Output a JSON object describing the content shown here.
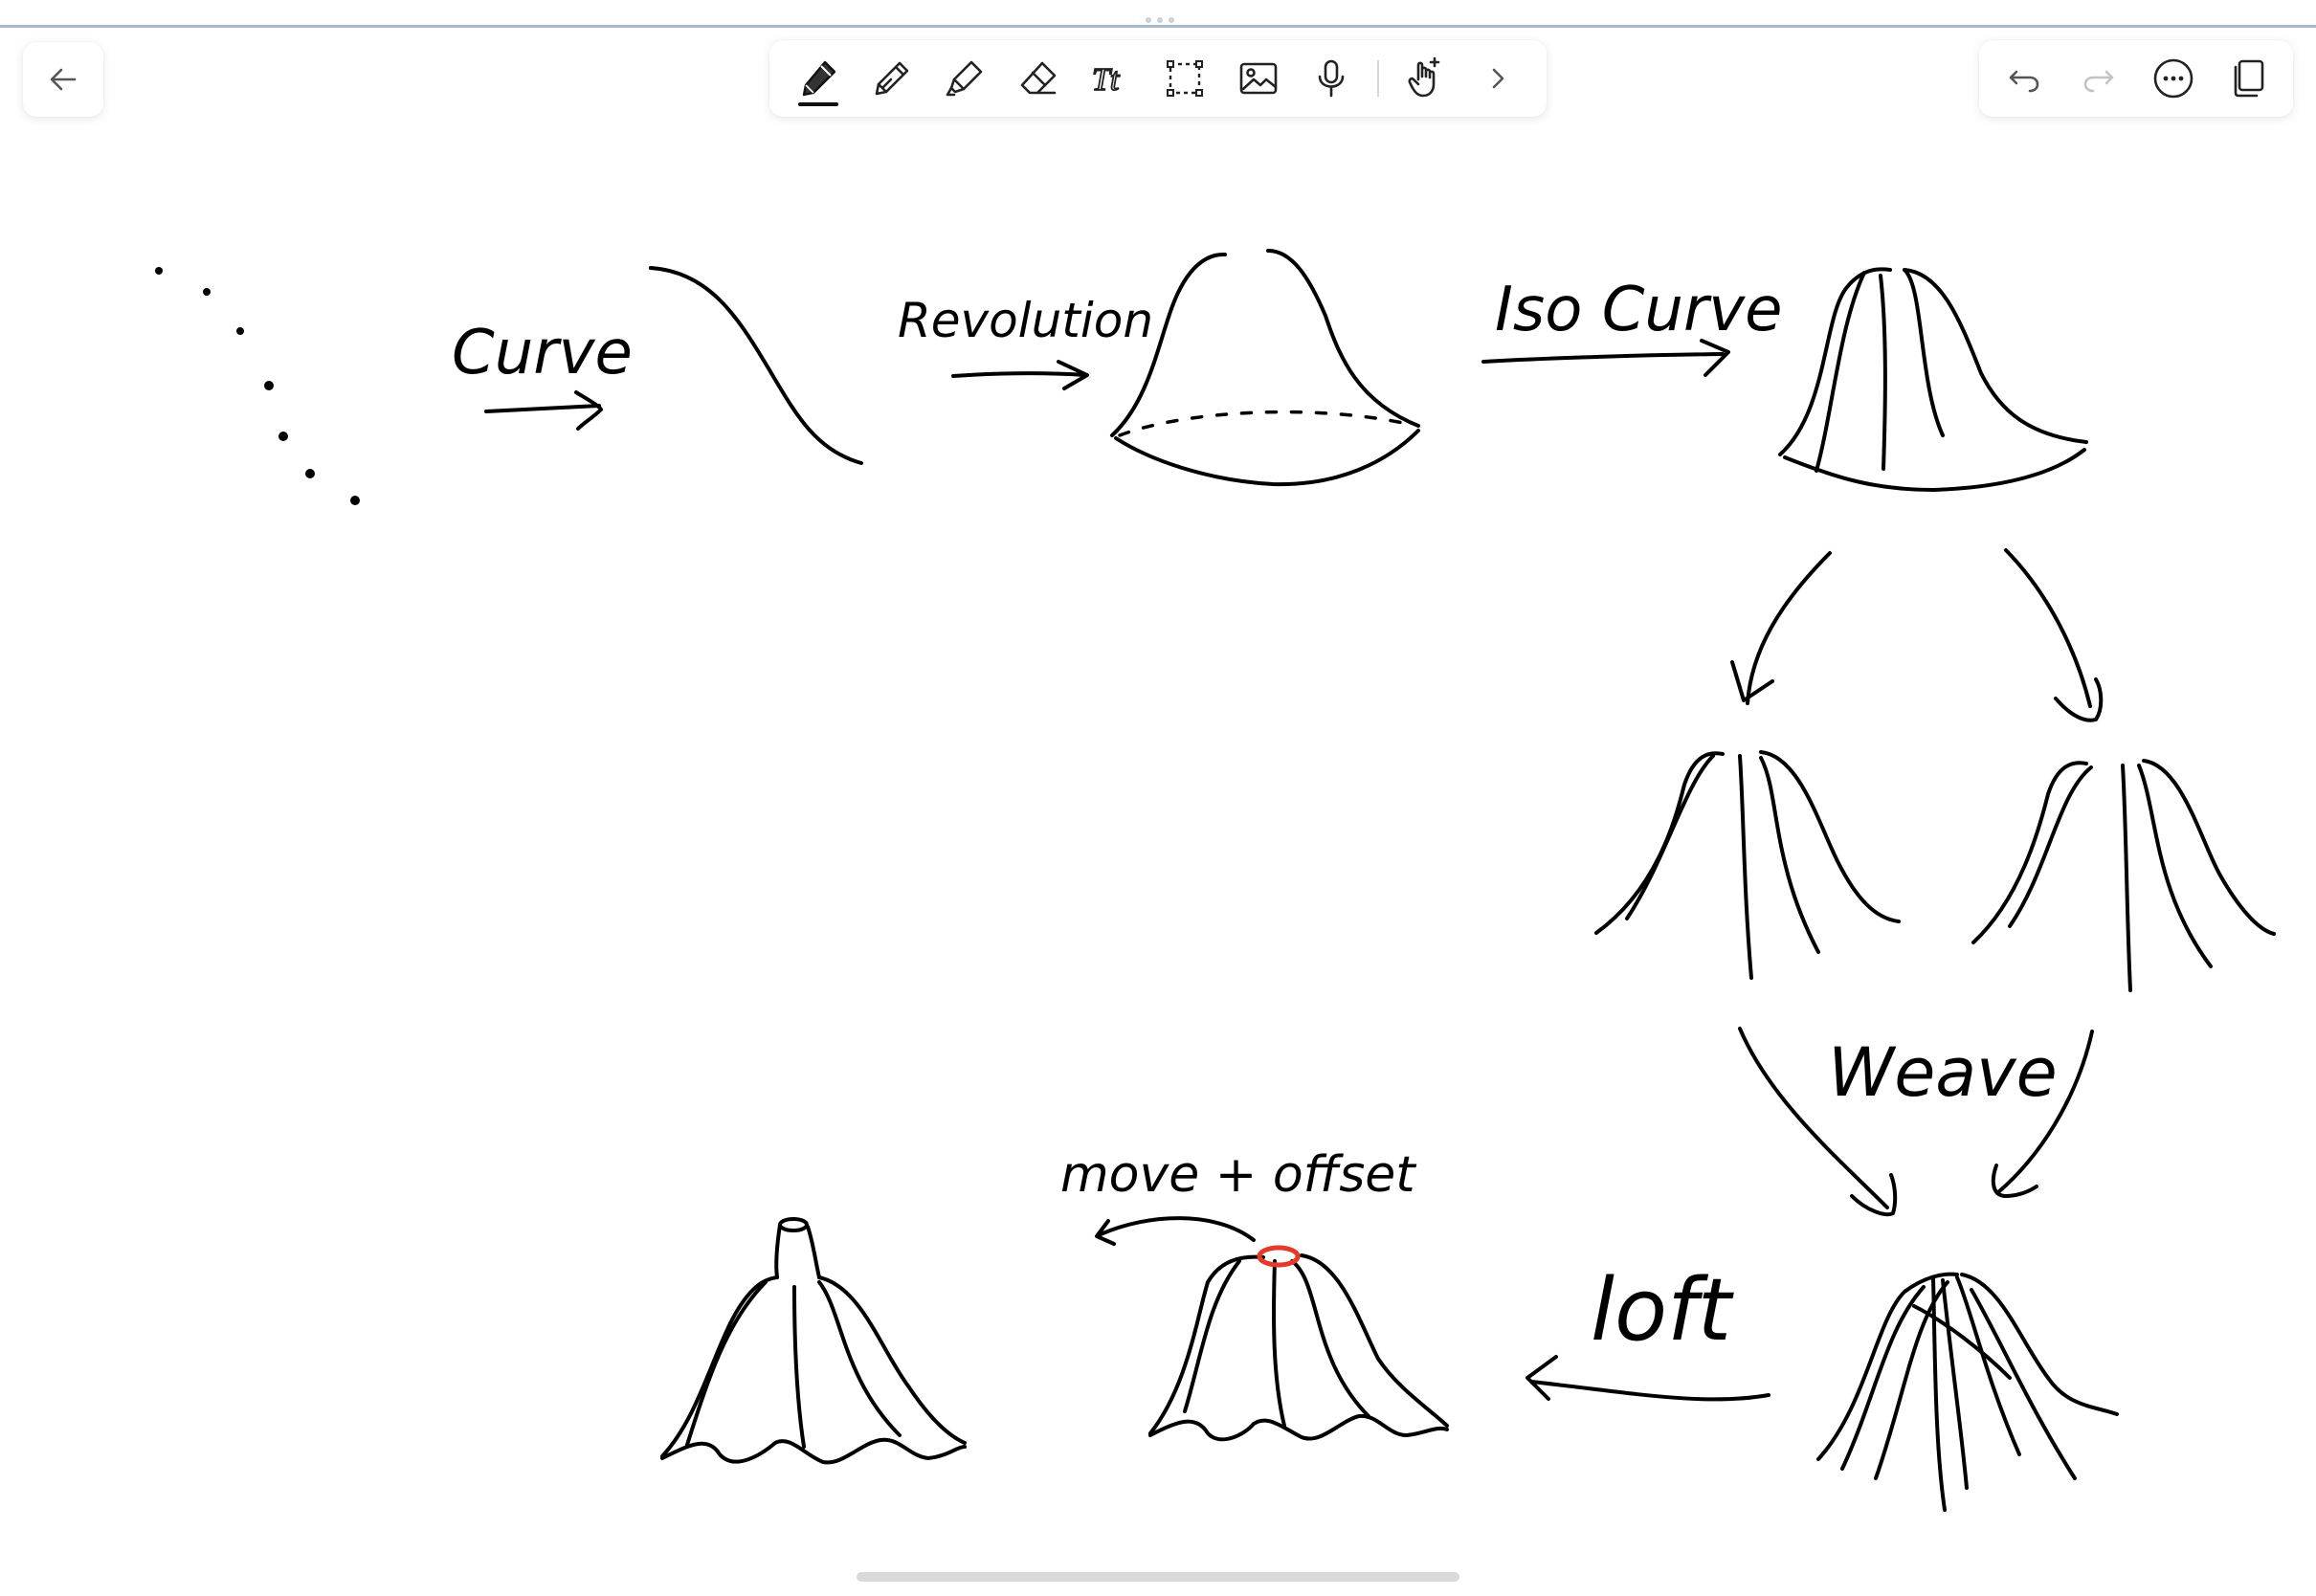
{
  "app": {
    "accent_color": "#111111",
    "top_rule_color": "#a9b8cc",
    "highlight_color": "#e53a2a"
  },
  "toolbar": {
    "back_icon": "arrow-left-icon",
    "tools": [
      {
        "name": "pen-tool",
        "icon": "pen-icon",
        "selected": true
      },
      {
        "name": "pencil-tool",
        "icon": "pencil-icon",
        "selected": false
      },
      {
        "name": "highlighter-tool",
        "icon": "highlighter-icon",
        "selected": false
      },
      {
        "name": "eraser-tool",
        "icon": "eraser-icon",
        "selected": false
      },
      {
        "name": "text-tool",
        "icon": "text-icon",
        "label": "Tt",
        "selected": false
      },
      {
        "name": "lasso-tool",
        "icon": "lasso-select-icon",
        "selected": false
      },
      {
        "name": "image-tool",
        "icon": "image-icon",
        "selected": false
      },
      {
        "name": "audio-tool",
        "icon": "microphone-icon",
        "selected": false
      },
      {
        "name": "touch-tool",
        "icon": "hand-pointer-icon",
        "selected": false
      },
      {
        "name": "more-tools",
        "icon": "chevron-right-icon",
        "selected": false
      }
    ],
    "text_tool_label": "Tt",
    "right": [
      {
        "name": "undo-button",
        "icon": "undo-icon",
        "enabled": true
      },
      {
        "name": "redo-button",
        "icon": "redo-icon",
        "enabled": false
      },
      {
        "name": "more-options-button",
        "icon": "more-horizontal-icon",
        "enabled": true
      },
      {
        "name": "pages-button",
        "icon": "pages-icon",
        "enabled": true
      }
    ]
  },
  "canvas": {
    "labels": {
      "curve": "Curve",
      "revolution": "Revolution",
      "iso_curve": "Iso Curve",
      "weave": "Weave",
      "loft": "loft",
      "move_offset": "move + offset"
    }
  }
}
